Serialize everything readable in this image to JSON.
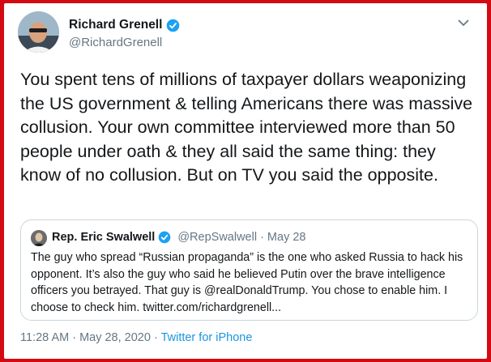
{
  "tweet": {
    "author": {
      "name": "Richard Grenell",
      "handle": "@RichardGrenell",
      "verified": true
    },
    "text": "You spent tens of millions of taxpayer dollars weaponizing the US government & telling Americans there was massive collusion. Your own committee interviewed more than 50 people under oath & they all said the same thing: they know of no collusion. But on TV you said the opposite.",
    "timestamp": "11:28 AM · May 28, 2020",
    "separator": " · ",
    "source": "Twitter for iPhone"
  },
  "quoted_tweet": {
    "author": {
      "name": "Rep. Eric Swalwell",
      "handle": "@RepSwalwell",
      "date": "· May 28",
      "verified": true
    },
    "text": "The guy who spread “Russian propaganda” is the one who asked Russia to hack his opponent. It’s also the guy who said he believed Putin over the brave intelligence officers you betrayed. That guy is @realDonaldTrump. You chose to enable him. I choose to check him. twitter.com/richardgrenell..."
  },
  "colors": {
    "border_red": "#d40a12",
    "verified_blue": "#1da1f2",
    "link_blue": "#1b95e0",
    "secondary_text": "#657786"
  },
  "icons": [
    "verified-badge-icon",
    "chevron-down-icon"
  ]
}
